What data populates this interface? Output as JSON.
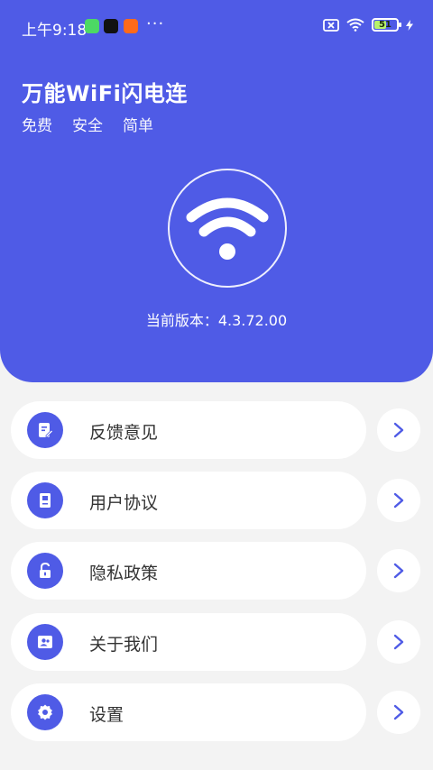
{
  "status_bar": {
    "time": "上午9:18",
    "more": "···",
    "battery": "51",
    "battery_level": 0.51
  },
  "header": {
    "title": "万能WiFi闪电连",
    "tags": [
      "免费",
      "安全",
      "简单"
    ],
    "version_label": "当前版本：4.3.72.00"
  },
  "menu": [
    {
      "label": "反馈意见",
      "icon": "edit-note-icon"
    },
    {
      "label": "用户协议",
      "icon": "book-icon"
    },
    {
      "label": "隐私政策",
      "icon": "unlock-icon"
    },
    {
      "label": "关于我们",
      "icon": "contacts-icon"
    },
    {
      "label": "设置",
      "icon": "gear-icon"
    }
  ],
  "colors": {
    "primary": "#4f5be6",
    "background": "#f3f3f3",
    "card": "#ffffff",
    "text": "#333333"
  }
}
